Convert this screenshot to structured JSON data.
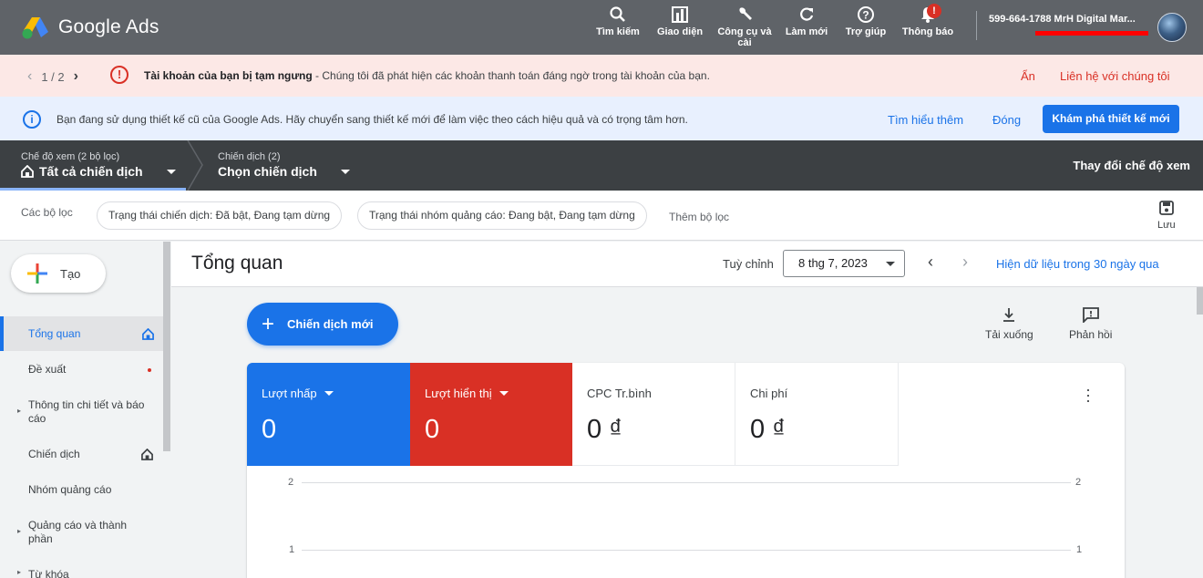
{
  "header": {
    "product_name": "Google Ads",
    "tools": [
      {
        "icon": "search-icon",
        "label": "Tìm kiếm"
      },
      {
        "icon": "appearance-icon",
        "label": "Giao diện"
      },
      {
        "icon": "wrench-icon",
        "label": "Công cụ và cài"
      },
      {
        "icon": "refresh-icon",
        "label": "Làm mới"
      },
      {
        "icon": "help-icon",
        "label": "Trợ giúp"
      },
      {
        "icon": "bell-icon",
        "label": "Thông báo",
        "badge": "!"
      }
    ],
    "account": "599-664-1788 MrH Digital Mar..."
  },
  "alert": {
    "pager": "1 / 2",
    "title": "Tài khoản của bạn bị tạm ngưng",
    "message": " - Chúng tôi đã phát hiện các khoản thanh toán đáng ngờ trong tài khoản của bạn.",
    "hide_label": "Ẩn",
    "contact_label": "Liên hệ với chúng tôi"
  },
  "info": {
    "message": "Bạn đang sử dụng thiết kế cũ của Google Ads. Hãy chuyển sang thiết kế mới để làm việc theo cách hiệu quả và có trọng tâm hơn.",
    "learn_more": "Tìm hiểu thêm",
    "close": "Đóng",
    "explore": "Khám phá thiết kế mới"
  },
  "viewbar": {
    "view_small": "Chế độ xem (2 bộ lọc)",
    "view_big": "Tất cả chiến dịch",
    "campaign_small": "Chiến dịch (2)",
    "campaign_big": "Chọn chiến dịch",
    "change_view": "Thay đổi chế độ xem"
  },
  "filters": {
    "label": "Các bộ lọc",
    "chips": [
      "Trạng thái chiến dịch: Đã bật, Đang tạm dừng",
      "Trạng thái nhóm quảng cáo: Đang bật, Đang tạm dừng"
    ],
    "add": "Thêm bộ lọc",
    "save": "Lưu"
  },
  "sidebar": {
    "create": "Tạo",
    "items": [
      {
        "label": "Tổng quan"
      },
      {
        "label": "Đề xuất"
      },
      {
        "label": "Thông tin chi tiết và báo cáo"
      },
      {
        "label": "Chiến dịch"
      },
      {
        "label": "Nhóm quảng cáo"
      },
      {
        "label": "Quảng cáo và thành phần"
      },
      {
        "label": "Từ khóa"
      }
    ]
  },
  "main": {
    "title": "Tổng quan",
    "custom_label": "Tuỳ chỉnh",
    "date": "8 thg 7, 2023",
    "show_data": "Hiện dữ liệu trong 30 ngày qua",
    "new_campaign": "Chiến dịch mới",
    "download": "Tải xuống",
    "feedback": "Phản hồi"
  },
  "metrics": [
    {
      "label": "Lượt nhấp",
      "value": "0",
      "color": "#1a73e8"
    },
    {
      "label": "Lượt hiển thị",
      "value": "0",
      "color": "#d93025"
    },
    {
      "label": "CPC Tr.bình",
      "value": "0 ₫"
    },
    {
      "label": "Chi phí",
      "value": "0 ₫"
    }
  ],
  "chart_data": {
    "type": "line",
    "y_ticks_left": [
      "2",
      "1"
    ],
    "y_ticks_right": [
      "2",
      "1"
    ],
    "series": []
  },
  "colors": {
    "accent": "#1a73e8",
    "danger": "#d93025",
    "header": "#5f6368",
    "viewbar": "#3c4043"
  }
}
